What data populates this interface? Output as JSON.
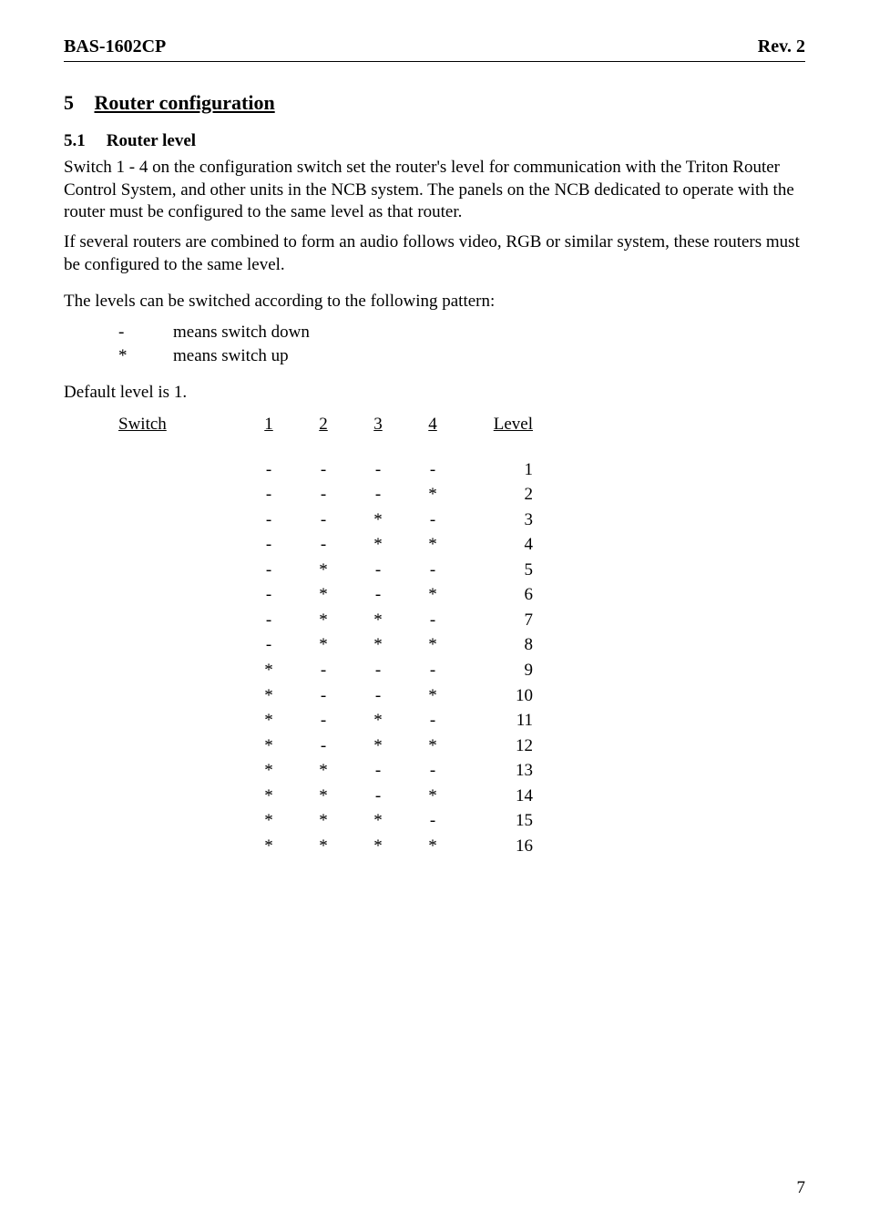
{
  "header": {
    "left": "BAS-1602CP",
    "right": "Rev. 2"
  },
  "section": {
    "number": "5",
    "title": "Router configuration"
  },
  "subsection": {
    "number": "5.1",
    "title": "Router level"
  },
  "paragraphs": {
    "p1": "Switch 1 - 4 on the configuration switch set the router's level for communication with the Triton Router Control System, and other units in the NCB system. The panels on the NCB dedicated to operate with the router must be configured to the same level as that router.",
    "p2": "If several routers are combined to form an audio follows video, RGB or similar system, these routers must be configured to the same level.",
    "p3": "The levels can be switched according to the following pattern:",
    "p4": "Default level is 1."
  },
  "legend": [
    {
      "sym": "-",
      "text": "means switch down"
    },
    {
      "sym": "*",
      "text": "means switch up"
    }
  ],
  "table": {
    "head": {
      "label": "Switch",
      "c1": "1",
      "c2": "2",
      "c3": "3",
      "c4": "4",
      "level": "Level"
    },
    "rows": [
      {
        "c1": "-",
        "c2": "-",
        "c3": "-",
        "c4": "-",
        "level": "1"
      },
      {
        "c1": "-",
        "c2": "-",
        "c3": "-",
        "c4": "*",
        "level": "2"
      },
      {
        "c1": "-",
        "c2": "-",
        "c3": "*",
        "c4": "-",
        "level": "3"
      },
      {
        "c1": "-",
        "c2": "-",
        "c3": "*",
        "c4": "*",
        "level": "4"
      },
      {
        "c1": "-",
        "c2": "*",
        "c3": "-",
        "c4": "-",
        "level": "5"
      },
      {
        "c1": "-",
        "c2": "*",
        "c3": "-",
        "c4": "*",
        "level": "6"
      },
      {
        "c1": "-",
        "c2": "*",
        "c3": "*",
        "c4": "-",
        "level": "7"
      },
      {
        "c1": "-",
        "c2": "*",
        "c3": "*",
        "c4": "*",
        "level": "8"
      },
      {
        "c1": "*",
        "c2": "-",
        "c3": "-",
        "c4": "-",
        "level": "9"
      },
      {
        "c1": "*",
        "c2": "-",
        "c3": "-",
        "c4": "*",
        "level": "10"
      },
      {
        "c1": "*",
        "c2": "-",
        "c3": "*",
        "c4": "-",
        "level": "11"
      },
      {
        "c1": "*",
        "c2": "-",
        "c3": "*",
        "c4": "*",
        "level": "12"
      },
      {
        "c1": "*",
        "c2": "*",
        "c3": "-",
        "c4": "-",
        "level": "13"
      },
      {
        "c1": "*",
        "c2": "*",
        "c3": "-",
        "c4": "*",
        "level": "14"
      },
      {
        "c1": "*",
        "c2": "*",
        "c3": "*",
        "c4": "-",
        "level": "15"
      },
      {
        "c1": "*",
        "c2": "*",
        "c3": "*",
        "c4": "*",
        "level": "16"
      }
    ]
  },
  "page_number": "7"
}
